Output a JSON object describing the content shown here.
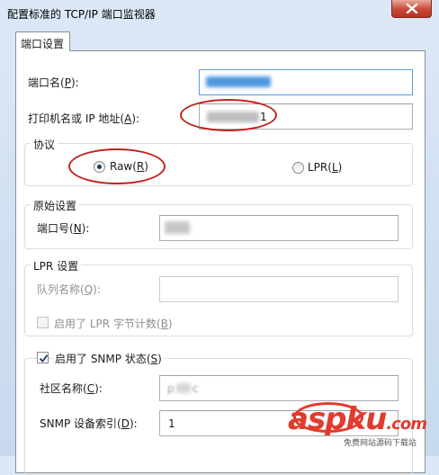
{
  "window": {
    "title": "配置标准的 TCP/IP 端口监视器"
  },
  "tab": {
    "label": "端口设置"
  },
  "port_name": {
    "label": "端口名(",
    "key": "P",
    "label_end": "):",
    "value": ""
  },
  "printer_address": {
    "label": "打印机名或 IP 地址(",
    "key": "A",
    "label_end": "):",
    "value_suffix": "1"
  },
  "protocol": {
    "title": "协议",
    "raw": {
      "label": "Raw(",
      "key": "R",
      "label_end": ")",
      "selected": true
    },
    "lpr": {
      "label": "LPR(",
      "key": "L",
      "label_end": ")",
      "selected": false
    }
  },
  "raw_settings": {
    "title": "原始设置",
    "port_number": {
      "label": "端口号(",
      "key": "N",
      "label_end": "):",
      "value": ""
    }
  },
  "lpr_settings": {
    "title": "LPR 设置",
    "queue_name": {
      "label": "队列名称(",
      "key": "Q",
      "label_end": "):",
      "value": ""
    },
    "byte_counting": {
      "label": "启用了 LPR 字节计数(",
      "key": "B",
      "label_end": ")",
      "checked": false
    }
  },
  "snmp": {
    "enabled": {
      "label": "启用了 SNMP 状态(",
      "key": "S",
      "label_end": ")",
      "checked": true
    },
    "community": {
      "label": "社区名称(",
      "key": "C",
      "label_end": "):",
      "value_start": "p",
      "value_end": "c"
    },
    "device_index": {
      "label": "SNMP 设备索引(",
      "key": "D",
      "label_end": "):",
      "value": "1"
    }
  },
  "watermark": {
    "text": "aspku",
    "tld": ".com",
    "subtext": "免费网站源码下载站"
  },
  "colors": {
    "highlight": "#c4201c",
    "focus_border": "#569de5",
    "close_button": "#c74a3a"
  }
}
